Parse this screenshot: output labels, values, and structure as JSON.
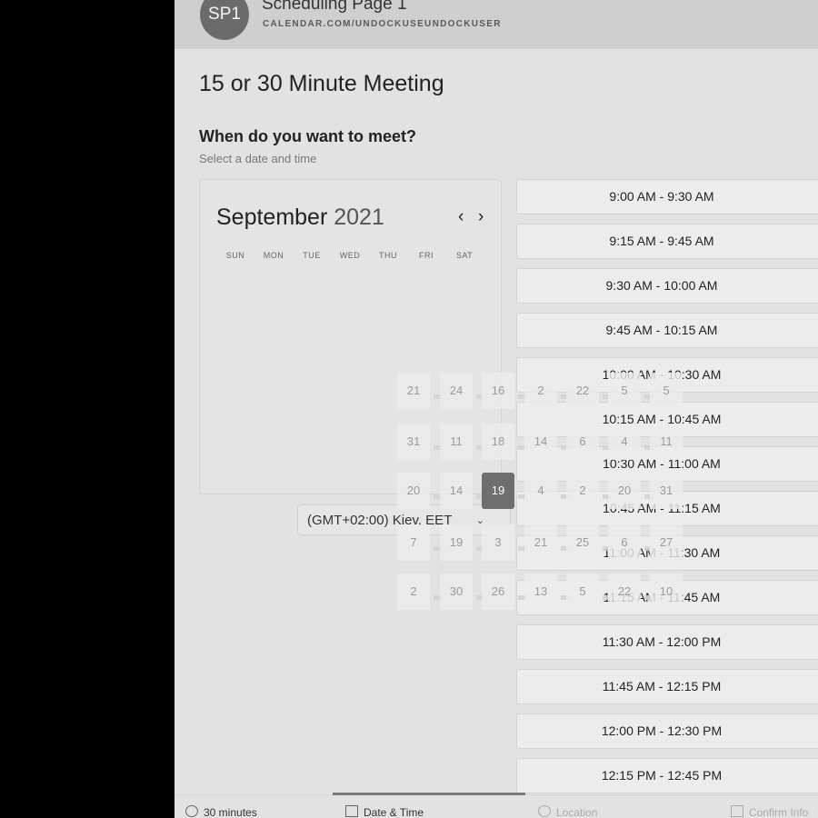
{
  "header": {
    "avatar_initials": "SP1",
    "title": "Scheduling Page 1",
    "subtitle": "CALENDAR.COM/UNDOCKUSEUNDOCKUSER"
  },
  "meeting_title": "15 or 30 Minute Meeting",
  "question": "When do you want to meet?",
  "hint": "Select a date and time",
  "calendar": {
    "month": "September",
    "year": "2021",
    "prev_icon": "chevron-left-icon",
    "next_icon": "chevron-right-icon",
    "prev_glyph": "‹",
    "next_glyph": "›",
    "weekdays": [
      "SUN",
      "MON",
      "TUE",
      "WED",
      "THU",
      "FRI",
      "SAT"
    ],
    "overlay_grid": [
      [
        "21",
        "24",
        "16",
        "2",
        "22",
        "5",
        "5"
      ],
      [
        "31",
        "11",
        "18",
        "14",
        "6",
        "4",
        "11"
      ],
      [
        "20",
        "14",
        "19",
        "4",
        "2",
        "20",
        "31"
      ],
      [
        "7",
        "19",
        "3",
        "21",
        "25",
        "6",
        "27"
      ],
      [
        "2",
        "30",
        "26",
        "13",
        "5",
        "22",
        "10"
      ]
    ],
    "selected_day": "19"
  },
  "timezone": {
    "label": "(GMT+02:00) Kiev, EET",
    "icon": "chevron-down-icon",
    "chevron_glyph": "⌄"
  },
  "time_slots": [
    "9:00 AM - 9:30 AM",
    "9:15 AM - 9:45 AM",
    "9:30 AM - 10:00 AM",
    "9:45 AM - 10:15 AM",
    "10:00 AM - 10:30 AM",
    "10:15 AM - 10:45 AM",
    "10:30 AM - 11:00 AM",
    "10:45 AM - 11:15 AM",
    "11:00 AM - 11:30 AM",
    "11:15 AM - 11:45 AM",
    "11:30 AM - 12:00 PM",
    "11:45 AM - 12:15 PM",
    "12:00 PM - 12:30 PM",
    "12:15 PM - 12:45 PM"
  ],
  "steps": [
    {
      "label": "30 minutes",
      "icon": "clock-icon",
      "active": false,
      "dim": false
    },
    {
      "label": "Date & Time",
      "icon": "calendar-icon",
      "active": true,
      "dim": false
    },
    {
      "label": "Location",
      "icon": "location-icon",
      "active": false,
      "dim": true
    },
    {
      "label": "Confirm Info",
      "icon": "confirm-icon",
      "active": false,
      "dim": true
    }
  ],
  "colors": {
    "page_bg": "#e2e2e2",
    "header_bg": "#cfcfcf",
    "selected_day_bg": "#6e6e6e",
    "outer_bg": "#000000"
  }
}
